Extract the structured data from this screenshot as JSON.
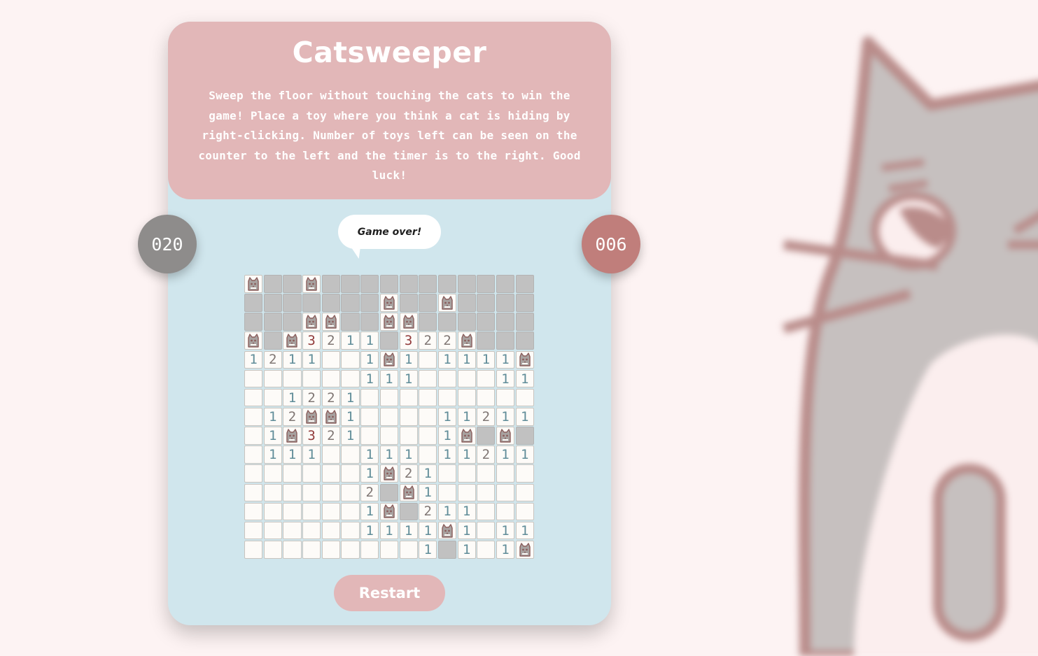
{
  "game": {
    "title": "Catsweeper",
    "description": "Sweep the floor without touching the cats to win the game! Place a toy where you think a cat is hiding by right-clicking. Number of toys left can be seen on the counter to the left and the timer is to the right. Good luck!",
    "toys_counter": "020",
    "timer": "006",
    "status_message": "Game over!",
    "restart_label": "Restart"
  },
  "board": {
    "legend": {
      "C": "cat-icon",
      "#": "closed-tile",
      ".": "empty-tile",
      "1-8": "number-tile"
    },
    "rows": [
      "C##C###########",
      "#######C##C####",
      "###CC##CC######",
      "C#C3211#322C###",
      "1211..1C1.1111C",
      "......111....11",
      "..1221.........",
      ".12CC1....11211",
      ".1C321....1C#C#",
      ".111..111.11211",
      "......1C21.....",
      "......2#C1.....",
      "......1C#211...",
      "......1111C1.11",
      ".........1#1.1C"
    ]
  },
  "colors": {
    "page_bg": "#fdf3f3",
    "card_bg": "#d0e6ed",
    "header_bg": "#e2b7b8",
    "toys_counter_bg": "#8e8c8b",
    "timer_bg": "#c07e7b",
    "closed_tile": "#c1c1c1",
    "open_tile": "#fdfbf8"
  }
}
